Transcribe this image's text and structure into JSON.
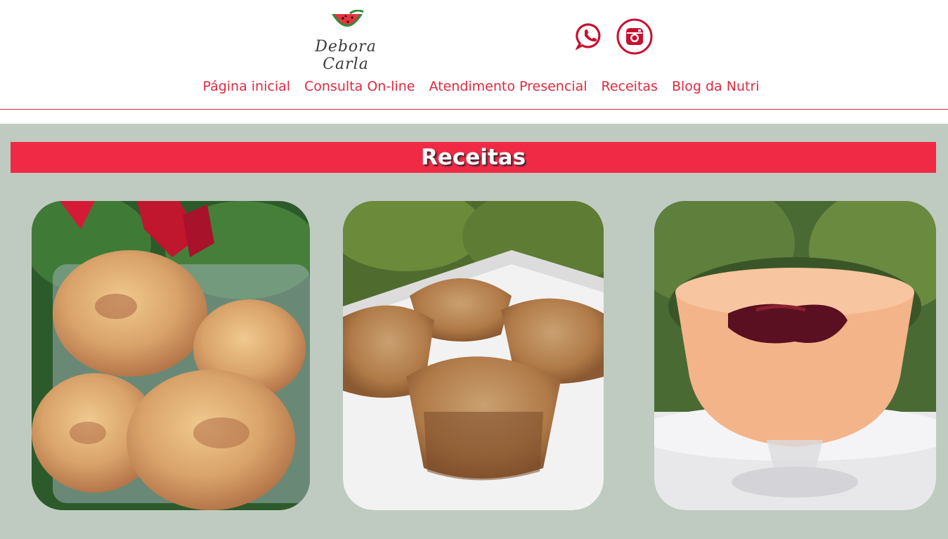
{
  "brand": {
    "name": "Debora Carla",
    "logo_icon": "watermelon-icon"
  },
  "social": [
    {
      "name": "whatsapp",
      "icon": "whatsapp-icon"
    },
    {
      "name": "instagram",
      "icon": "instagram-icon"
    }
  ],
  "nav": {
    "items": [
      {
        "label": "Página inicial"
      },
      {
        "label": "Consulta On-line"
      },
      {
        "label": "Atendimento Presencial"
      },
      {
        "label": "Receitas"
      },
      {
        "label": "Blog da Nutri"
      }
    ]
  },
  "page": {
    "title": "Receitas"
  },
  "recipes": [
    {
      "image": "breaded-croquettes-photo"
    },
    {
      "image": "cinnamon-muffins-photo"
    },
    {
      "image": "creamy-dessert-cup-photo"
    }
  ],
  "colors": {
    "accent": "#f02a45",
    "nav_text": "#e0293f",
    "background": "#bfcbc0",
    "title_text": "#ffffff"
  }
}
